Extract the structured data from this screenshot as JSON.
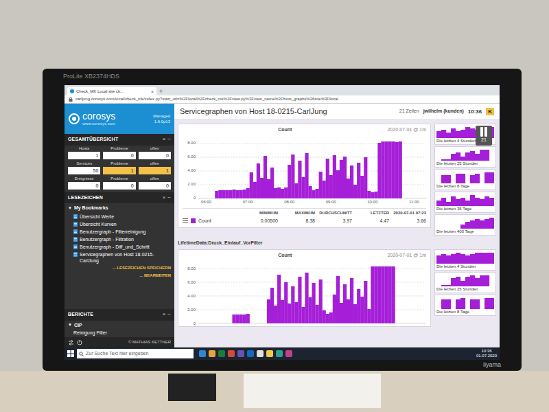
{
  "monitor": {
    "model": "ProLite XB2374HDS",
    "brand": "iiyama"
  },
  "browser": {
    "tab": "Check_MK Local site ck...",
    "tab_close": "×",
    "new_tab": "+",
    "url": "carljung.corosys.com/local/check_mk/index.py?start_url=%2Flocal%2Fcheck_mk%2Fview.py%3Fview_name%3Dhost_graphs%26site%3Dlocal"
  },
  "sidebar": {
    "logo": "corosys",
    "logo_url": "www.corosys.com",
    "edition": "Managed",
    "version": "1.6.0p13",
    "overview": {
      "title": "GESAMTÜBERSICHT",
      "controls": [
        "×",
        "−"
      ],
      "groups": [
        {
          "labels": [
            "Hosts",
            "Probleme",
            "offen"
          ],
          "values": [
            {
              "text": "1",
              "alert": false
            },
            {
              "text": "0",
              "alert": false
            },
            {
              "text": "0",
              "alert": false
            }
          ]
        },
        {
          "labels": [
            "Services",
            "Probleme",
            "offen"
          ],
          "values": [
            {
              "text": "50",
              "alert": false
            },
            {
              "text": "1",
              "alert": true
            },
            {
              "text": "1",
              "alert": true
            }
          ]
        },
        {
          "labels": [
            "Ereignisse",
            "Probleme",
            "offen"
          ],
          "values": [
            {
              "text": "0",
              "alert": false
            },
            {
              "text": "0",
              "alert": false
            },
            {
              "text": "0",
              "alert": false
            }
          ]
        }
      ]
    },
    "bookmarks": {
      "title": "LESEZEICHEN",
      "controls": [
        "×",
        "−"
      ],
      "folder": {
        "toggle": "▼",
        "label": "My Bookmarks"
      },
      "items": [
        "Übersicht Werte",
        "Übersicht Kurven",
        "Benutzergraph - Filterreinigung",
        "Benutzergraph - Filtration",
        "Benutzergraph - Diff_und_Schritt",
        "Servicegraphen von Host 18-0215-CarlJung"
      ],
      "actions": [
        "... LESEZEICHEN SPEICHERN",
        "... BEARBEITEN"
      ]
    },
    "reports": {
      "title": "BERICHTE",
      "controls": [
        "×",
        "−"
      ],
      "folder": {
        "toggle": "▼",
        "label": "CIP"
      },
      "items": [
        "Reinigung Filter"
      ]
    },
    "footer": "© MATHIAS KETTNER"
  },
  "header": {
    "title": "Servicegraphen von Host 18-0215-CarlJung",
    "rows": "21 Zeilen",
    "user": "jwilhelm (kunden)",
    "time": "10:36",
    "badge": "K"
  },
  "overlay": {
    "count": "21"
  },
  "graphs": [
    {
      "title": "Count",
      "stamp": "2020-07-01 @ 1m",
      "y_ticks": [
        "8.00",
        "6.00",
        "4.00",
        "2.00",
        "0"
      ],
      "x_ticks": [
        "06:00",
        "07:00",
        "08:00",
        "09:00",
        "10:00",
        "11:00"
      ],
      "values": [
        0,
        0,
        0,
        0,
        0,
        1.1,
        1.2,
        1.2,
        1.2,
        1.2,
        1.3,
        1.2,
        1.2,
        1.3,
        1.5,
        3.8,
        2.4,
        5.1,
        3.0,
        6.2,
        2.8,
        4.5,
        1.5,
        1.6,
        1.4,
        1.6,
        4.9,
        6.4,
        2.2,
        5.5,
        3.1,
        6.6,
        1.8,
        1.2,
        1.4,
        3.9,
        2.6,
        5.8,
        3.4,
        6.3,
        4.1,
        5.6,
        6.1,
        2.9,
        4.8,
        2.0,
        5.2,
        3.3,
        6.0,
        1.1,
        0.9,
        1.0,
        8.1,
        8.3,
        8.3,
        8.3,
        8.3,
        8.2,
        8.3,
        0,
        0,
        0,
        0,
        0,
        0,
        0
      ],
      "legend": {
        "columns": [
          "MINIMUM",
          "MAXIMUM",
          "DURCHSCHNITT",
          "LETZTER",
          "2020-07-01 07:23"
        ],
        "rows": [
          {
            "name": "Count",
            "cells": [
              "0.00500",
              "8.38",
              "3.97",
              "4.47",
              "3.66"
            ]
          }
        ]
      },
      "thumbs": [
        {
          "label": "Die letzten 4 Stunden",
          "values": [
            5,
            6,
            4,
            7,
            5,
            6,
            8,
            7,
            6,
            7,
            8,
            8
          ]
        },
        {
          "label": "Die letzten 25 Stunden",
          "values": [
            0,
            1,
            1,
            5,
            6,
            3,
            6,
            7,
            5,
            8,
            8,
            0
          ]
        },
        {
          "label": "Die letzten 8 Tage",
          "values": [
            0,
            6,
            6,
            0,
            7,
            7,
            0,
            6,
            7,
            0,
            8,
            8
          ]
        },
        {
          "label": "Die letzten 35 Tage",
          "values": [
            4,
            6,
            3,
            7,
            5,
            6,
            4,
            8,
            6,
            5,
            7,
            6
          ]
        },
        {
          "label": "Die letzten 400 Tage",
          "values": [
            0,
            0,
            0,
            0,
            0,
            3,
            5,
            6,
            7,
            6,
            7,
            8
          ]
        }
      ]
    },
    {
      "section": "LifetimeData:Druck_Einlauf_VorFilter",
      "title": "Count",
      "stamp": "2020-07-01 @ 1m",
      "y_ticks": [
        "8.00",
        "6.00",
        "4.00",
        "2.00",
        "0"
      ],
      "x_ticks": [],
      "values": [
        0,
        0,
        0,
        0,
        0,
        0,
        0,
        0,
        0,
        0,
        1.3,
        1.3,
        1.3,
        1.3,
        1.4,
        0,
        0,
        0,
        0,
        0,
        3.5,
        5.2,
        2.6,
        7.1,
        3.4,
        6.0,
        2.9,
        5.4,
        3.1,
        6.8,
        2.4,
        7.4,
        3.8,
        5.9,
        2.7,
        6.4,
        1.9,
        1.4,
        1.6,
        4.2,
        6.9,
        3.0,
        5.7,
        3.5,
        6.6,
        2.8,
        5.0,
        3.9,
        6.2,
        2.1,
        8.3,
        8.3,
        8.3,
        8.3,
        8.3,
        8.3,
        8.3,
        0,
        0,
        0,
        0,
        0,
        0,
        0,
        0,
        0
      ],
      "thumbs": [
        {
          "label": "Die letzten 4 Stunden",
          "values": [
            6,
            7,
            6,
            7,
            8,
            7,
            6,
            7,
            8,
            8,
            8,
            8
          ]
        },
        {
          "label": "Die letzten 25 Stunden",
          "values": [
            0,
            1,
            1,
            6,
            7,
            4,
            7,
            8,
            6,
            8,
            8,
            0
          ]
        },
        {
          "label": "Die letzten 8 Tage",
          "values": [
            0,
            7,
            7,
            0,
            7,
            8,
            0,
            7,
            7,
            0,
            8,
            8
          ]
        }
      ]
    }
  ],
  "taskbar": {
    "search_placeholder": "Zur Suche Text hier eingeben",
    "time": "10:36",
    "date": "01.07.2020"
  }
}
